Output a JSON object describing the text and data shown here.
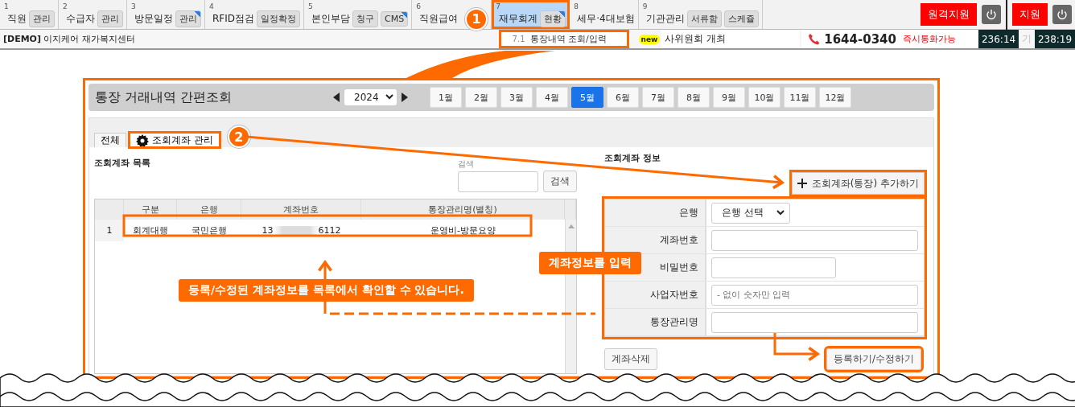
{
  "menu": [
    {
      "number": "1",
      "label": "직원",
      "selected": false,
      "buttons": [
        {
          "label": "관리",
          "marked": false
        }
      ]
    },
    {
      "number": "2",
      "label": "수급자",
      "selected": false,
      "buttons": [
        {
          "label": "관리",
          "marked": false
        }
      ]
    },
    {
      "number": "3",
      "label": "방문일정",
      "selected": false,
      "buttons": [
        {
          "label": "관리",
          "marked": true
        }
      ]
    },
    {
      "number": "4",
      "label": "RFID점검",
      "selected": false,
      "buttons": [
        {
          "label": "일정확정",
          "marked": false
        }
      ]
    },
    {
      "number": "5",
      "label": "본인부담",
      "selected": false,
      "buttons": [
        {
          "label": "청구",
          "marked": false
        },
        {
          "label": "CMS",
          "marked": true
        }
      ]
    },
    {
      "number": "6",
      "label": "직원급여",
      "selected": false,
      "step": "1"
    },
    {
      "number": "7",
      "label": "재무회계",
      "selected": true,
      "buttons": [
        {
          "label": "현황",
          "marked": true
        }
      ]
    },
    {
      "number": "8",
      "label": "세무·4대보험",
      "selected": false
    },
    {
      "number": "9",
      "label": "기관관리",
      "selected": false,
      "buttons": [
        {
          "label": "서류함",
          "marked": false
        },
        {
          "label": "스케쥴",
          "marked": false
        }
      ]
    }
  ],
  "remote_support": [
    "원격지원",
    "지원"
  ],
  "center_name": "**[DEMO]** 이지케어 재가복지센터",
  "submenu": {
    "number": "7.1",
    "label": "통장내역 조회/입력"
  },
  "new_badge": "new",
  "notice": "사위원회 개최",
  "phone": "1644-0340",
  "phone_status": "즉시통화가능",
  "timers": [
    "236:14",
    "238:19"
  ],
  "hidden_text": "기",
  "panel": {
    "title": "통장 거래내역 간편조회",
    "year": "2024",
    "months": [
      {
        "label": "1월",
        "selected": false
      },
      {
        "label": "2월",
        "selected": false
      },
      {
        "label": "3월",
        "selected": false
      },
      {
        "label": "4월",
        "selected": false
      },
      {
        "label": "5월",
        "selected": true
      },
      {
        "label": "6월",
        "selected": false
      },
      {
        "label": "7월",
        "selected": false
      },
      {
        "label": "8월",
        "selected": false
      },
      {
        "label": "9월",
        "selected": false
      },
      {
        "label": "10월",
        "selected": false
      },
      {
        "label": "11월",
        "selected": false
      },
      {
        "label": "12월",
        "selected": false
      }
    ],
    "tabs": [
      {
        "label": "전체",
        "selected": false,
        "kind": "plain"
      },
      {
        "label": "조회계좌 관리",
        "selected": true,
        "kind": "settings",
        "step": "2"
      }
    ],
    "list": {
      "title": "조회계좌 목록",
      "search_label": "검색",
      "search_button": "검색",
      "columns": [
        "구분",
        "은행",
        "계좌번호",
        "통장관리명(별칭)"
      ],
      "rows": [
        {
          "number": "1",
          "type": "회계대행",
          "bank": "국민은행",
          "account_start": "13",
          "account_end": "6112",
          "alias": "운영비-방문요양"
        }
      ]
    },
    "form": {
      "title": "조회계좌 정보",
      "add_button": "조회계좌(통장) 추가하기",
      "fields": [
        {
          "label": "은행",
          "kind": "select",
          "value": "은행 선택"
        },
        {
          "label": "계좌번호",
          "kind": "text"
        },
        {
          "label": "비밀번호",
          "kind": "short"
        },
        {
          "label": "사업자번호",
          "kind": "text",
          "placeholder": "- 없이 숫자만 입력"
        },
        {
          "label": "통장관리명",
          "kind": "text"
        }
      ],
      "delete_button": "계좌삭제",
      "save_button": "등록하기/수정하기"
    }
  },
  "callouts": [
    {
      "text": "계좌정보를 입력"
    },
    {
      "text": "등록/수정된 계좌정보를 목록에서 확인할 수 있습니다."
    }
  ]
}
